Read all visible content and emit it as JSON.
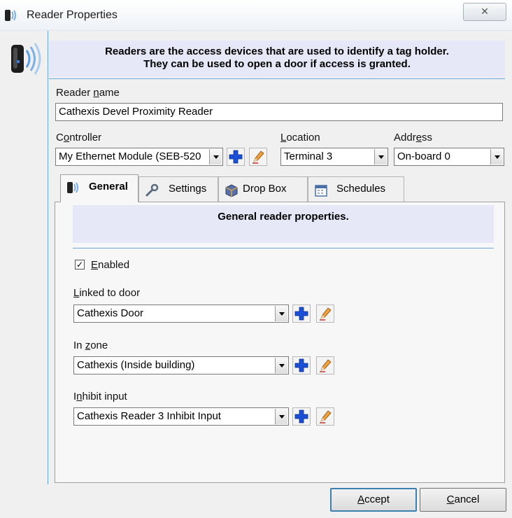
{
  "window": {
    "title": "Reader Properties",
    "close_glyph": "✕",
    "banner_line1": "Readers are the access devices that are used to identify a tag holder.",
    "banner_line2": "They can be used to open a door if access is granted."
  },
  "form": {
    "reader_name_label_pre": "Reader ",
    "reader_name_label_key": "n",
    "reader_name_label_post": "ame",
    "reader_name_value": "Cathexis Devel Proximity Reader",
    "controller_label_pre": "C",
    "controller_label_key": "o",
    "controller_label_post": "ntroller",
    "controller_value": "My Ethernet Module (SEB-520",
    "location_label_key": "L",
    "location_label_post": "ocation",
    "location_value": "Terminal 3",
    "address_label_pre": "Addr",
    "address_label_key": "e",
    "address_label_post": "ss",
    "address_value": "On-board 0"
  },
  "tabs": [
    {
      "label": "General",
      "icon": "reader-icon",
      "active": true
    },
    {
      "label": "Settings",
      "icon": "wrench-icon",
      "active": false
    },
    {
      "label": "Drop Box",
      "icon": "box-icon",
      "active": false
    },
    {
      "label": "Schedules",
      "icon": "calendar-icon",
      "active": false
    }
  ],
  "general": {
    "banner": "General reader properties.",
    "enabled_checked": true,
    "enabled_mark": "✓",
    "enabled_label_key": "E",
    "enabled_label_post": "nabled",
    "linked_door_label_key": "L",
    "linked_door_label_post": "inked to door",
    "linked_door_value": "Cathexis Door",
    "zone_label_pre": "In ",
    "zone_label_key": "z",
    "zone_label_post": "one",
    "zone_value": "Cathexis (Inside building)",
    "inhibit_label_pre": "I",
    "inhibit_label_key": "n",
    "inhibit_label_post": "hibit input",
    "inhibit_value": "Cathexis Reader 3 Inhibit Input"
  },
  "buttons": {
    "accept_key": "A",
    "accept_post": "ccept",
    "cancel_key": "C",
    "cancel_post": "ancel"
  },
  "colors": {
    "accent_line": "#6aa7d8",
    "banner_bg": "#e6e8f8",
    "add_icon": "#1a4fd6"
  }
}
